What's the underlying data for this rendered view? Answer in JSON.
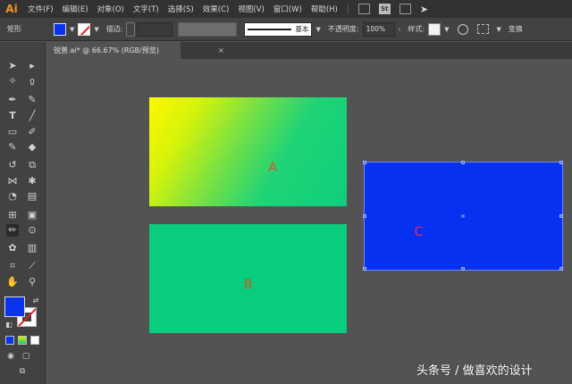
{
  "app": {
    "logo": "Ai"
  },
  "menu": [
    "文件(F)",
    "编辑(E)",
    "对象(O)",
    "文字(T)",
    "选择(S)",
    "效果(C)",
    "视图(V)",
    "窗口(W)",
    "帮助(H)"
  ],
  "menubar_icons": {
    "st": "St"
  },
  "control": {
    "object_type": "矩形",
    "stroke_label": "描边",
    "stroke_profile": "基本",
    "opacity_label": "不透明度",
    "opacity_value": "100%",
    "style_label": "样式",
    "transform_label": "变换",
    "fill_color": "#0732f0"
  },
  "document": {
    "tab_title": "锐普.ai* @ 66.67% (RGB/预览)",
    "close": "×"
  },
  "canvas": {
    "shapes": [
      {
        "label": "A",
        "fill": "linear-gradient yellow to green",
        "label_color": "#d9531e"
      },
      {
        "label": "B",
        "fill": "#07cd7d",
        "label_color": "#d9531e"
      },
      {
        "label": "C",
        "fill": "#0731f0",
        "label_color": "#ff2060",
        "selected": true
      }
    ]
  },
  "watermark": "头条号 / 做喜欢的设计",
  "tools": [
    "selection-icon",
    "direct-selection-icon",
    "magic-wand-icon",
    "lasso-icon",
    "pen-icon",
    "curvature-icon",
    "type-icon",
    "line-icon",
    "rectangle-icon",
    "paintbrush-icon",
    "shaper-icon",
    "eraser-icon",
    "rotate-icon",
    "scale-icon",
    "width-icon",
    "puppet-warp-icon",
    "shape-builder-icon",
    "perspective-icon",
    "mesh-icon",
    "gradient-icon",
    "eyedropper-icon",
    "blend-icon",
    "symbol-sprayer-icon",
    "column-graph-icon",
    "artboard-icon",
    "slice-icon",
    "hand-icon",
    "zoom-icon"
  ]
}
